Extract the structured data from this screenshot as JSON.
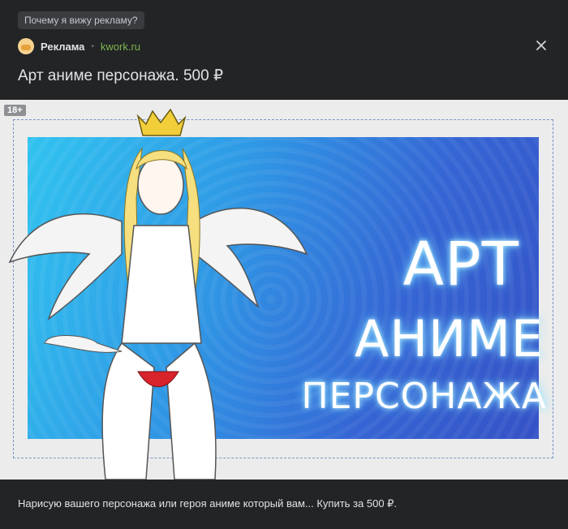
{
  "why_ad": "Почему я вижу рекламу?",
  "source": {
    "name": "Реклама",
    "separator": "•",
    "domain": "kwork.ru"
  },
  "close_icon": "close-icon",
  "post_title": "Арт аниме персонажа. 500 ₽",
  "banner": {
    "age_badge": "18+",
    "line1": "АРТ",
    "line2": "АНИМЕ",
    "line3": "ПЕРСОНАЖА"
  },
  "footer_text": "Нарисую вашего персонажа или героя аниме который вам... Купить за 500 ₽.",
  "colors": {
    "background": "#222426",
    "domain": "#7fb44f",
    "banner_blue": "#3565d4"
  }
}
